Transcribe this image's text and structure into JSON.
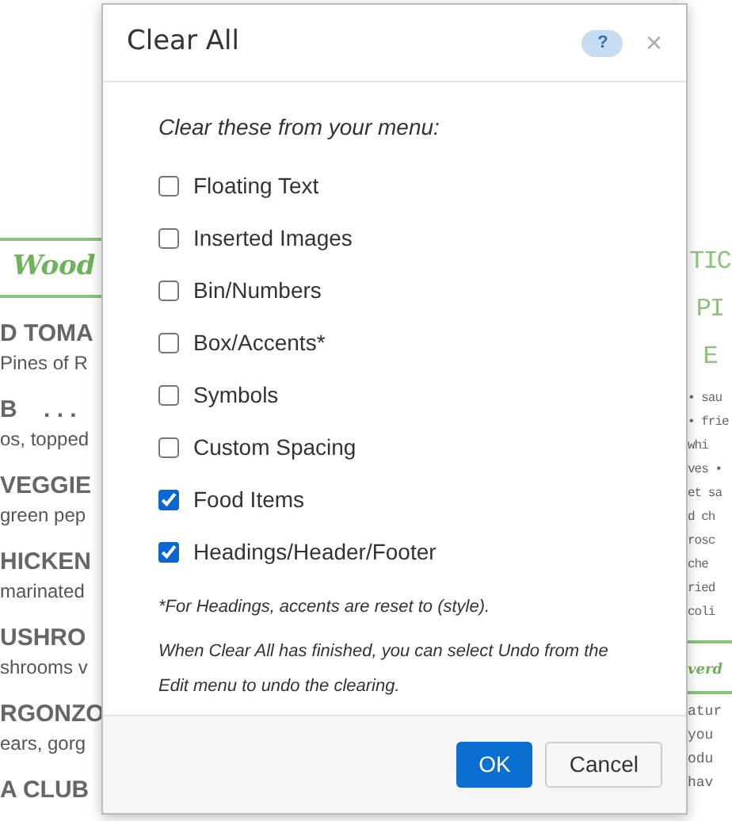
{
  "background_menu": {
    "left_heading": "Wood",
    "left_items": [
      {
        "name": "D TOMA",
        "desc": "Pines of R"
      },
      {
        "name": "B    . . .",
        "desc": "os, topped"
      },
      {
        "name": "VEGGIE",
        "desc": "green pep"
      },
      {
        "name": "HICKEN",
        "desc": "marinated"
      },
      {
        "name": "USHRO",
        "desc": "shrooms v"
      },
      {
        "name": "RGONZO",
        "desc": "ears, gorg"
      },
      {
        "name": "A CLUB"
      }
    ],
    "right_title": [
      "TIC",
      "PI",
      "E"
    ],
    "right_lines": [
      "• sau",
      "• frie",
      "whi",
      "ves •",
      "et sa",
      "d ch",
      "rosc",
      "che",
      "ried",
      "coli"
    ],
    "right_heading": "verd",
    "right_lines_2": [
      "atur",
      "you",
      "odu",
      "hav"
    ]
  },
  "dialog": {
    "title": "Clear All",
    "help": "?",
    "close": "×",
    "intro": "Clear these from your menu:",
    "options": [
      {
        "label": "Floating Text",
        "checked": false
      },
      {
        "label": "Inserted Images",
        "checked": false
      },
      {
        "label": "Bin/Numbers",
        "checked": false
      },
      {
        "label": "Box/Accents*",
        "checked": false
      },
      {
        "label": "Symbols",
        "checked": false
      },
      {
        "label": "Custom Spacing",
        "checked": false
      },
      {
        "label": "Food Items",
        "checked": true
      },
      {
        "label": "Headings/Header/Footer",
        "checked": true
      }
    ],
    "footnote": "*For Headings, accents are reset to (style).",
    "note": "When Clear All has finished, you can select Undo from the Edit menu to undo the clearing.",
    "buttons": [
      {
        "label": "OK",
        "kind": "primary"
      },
      {
        "label": "Cancel",
        "kind": "secondary"
      }
    ]
  }
}
